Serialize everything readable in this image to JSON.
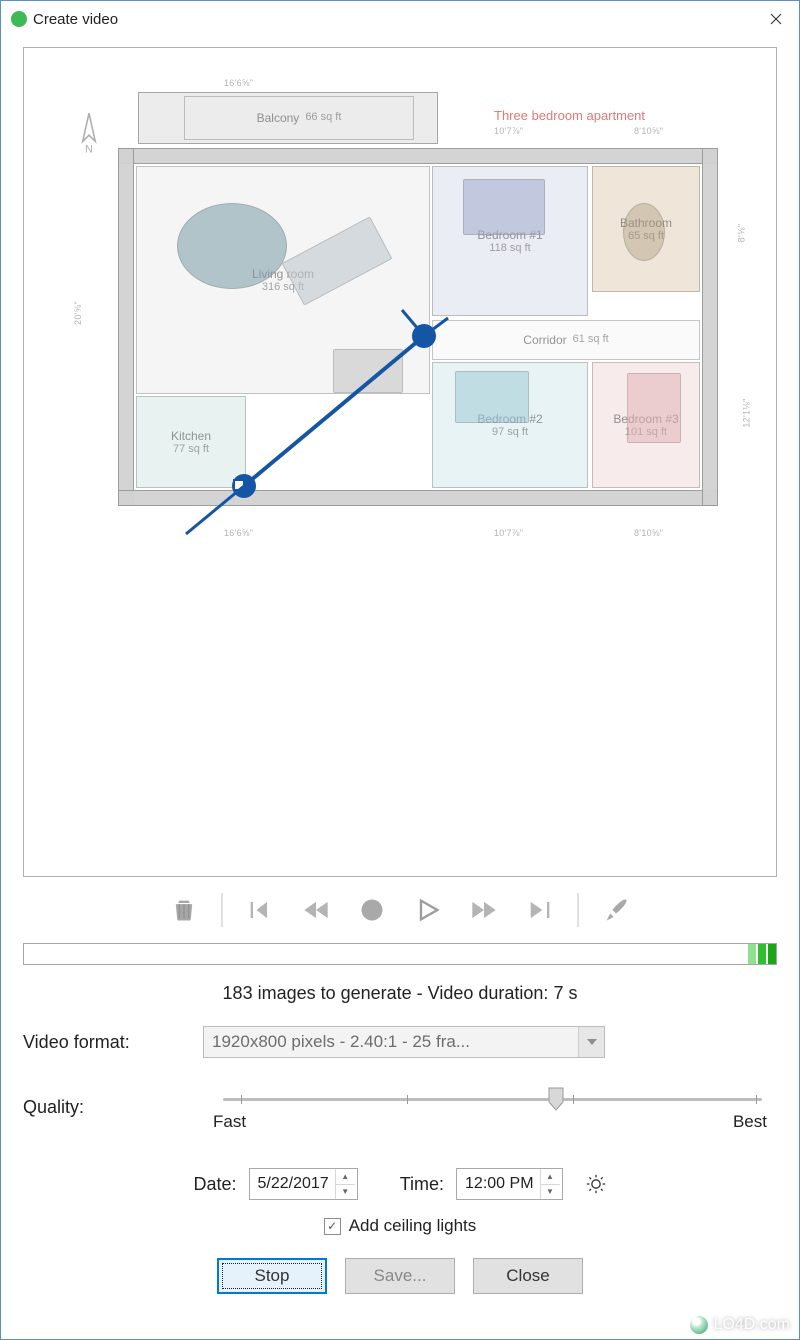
{
  "window": {
    "title": "Create video"
  },
  "floorplan": {
    "title": "Three bedroom apartment",
    "compass_label": "N",
    "rooms": {
      "balcony": {
        "label": "Balcony",
        "area": "66 sq ft"
      },
      "living": {
        "label": "Living room",
        "area": "316 sq ft"
      },
      "kitchen": {
        "label": "Kitchen",
        "area": "77 sq ft"
      },
      "bedroom1": {
        "label": "Bedroom #1",
        "area": "118 sq ft"
      },
      "bedroom2": {
        "label": "Bedroom #2",
        "area": "97 sq ft"
      },
      "bedroom3": {
        "label": "Bedroom #3",
        "area": "101 sq ft"
      },
      "bathroom": {
        "label": "Bathroom",
        "area": "65 sq ft"
      },
      "corridor": {
        "label": "Corridor",
        "area": "61 sq ft"
      }
    },
    "dims": {
      "top_left": "16'6⅝\"",
      "top_mid": "10'7⅞\"",
      "top_right": "8'10⅝\"",
      "left": "20'⅝\"",
      "right_upper": "8'⅝\"",
      "right_lower": "12'1⅛\"",
      "bottom_left": "16'6⅝\"",
      "bottom_mid": "10'7⅞\"",
      "bottom_right": "8'10⅝\""
    }
  },
  "status": "183 images to generate - Video duration: 7 s",
  "progress_percent": 96,
  "video_format": {
    "label": "Video format:",
    "value": "1920x800 pixels - 2.40:1 - 25 fra..."
  },
  "quality": {
    "label": "Quality:",
    "fast": "Fast",
    "best": "Best",
    "value_pct": 62
  },
  "date": {
    "label": "Date:",
    "value": "5/22/2017"
  },
  "time": {
    "label": "Time:",
    "value": "12:00 PM"
  },
  "ceiling": {
    "label": "Add ceiling lights",
    "checked": true
  },
  "buttons": {
    "stop": "Stop",
    "save": "Save...",
    "close": "Close"
  },
  "watermark": "LO4D.com"
}
